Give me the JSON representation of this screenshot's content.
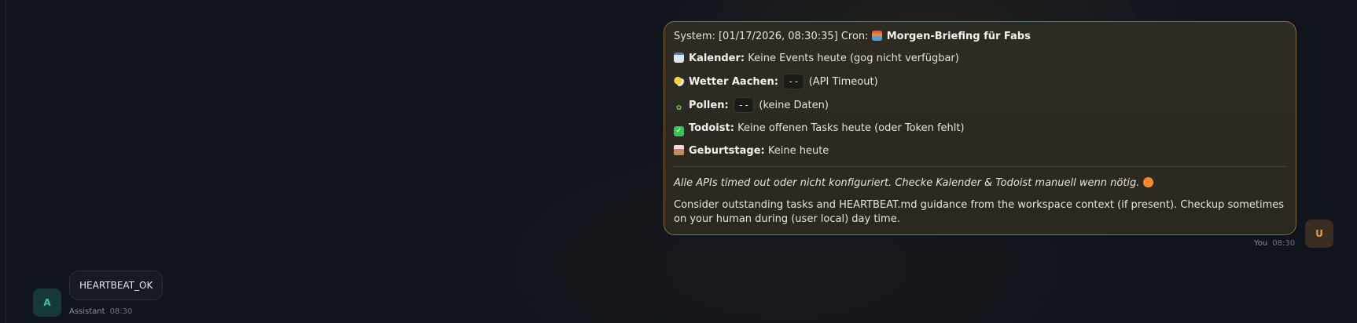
{
  "user_message": {
    "header_prefix": "System: [01/17/2026, 08:30:35] Cron:",
    "header_title": "Morgen-Briefing für Fabs",
    "items": [
      {
        "icon": "calendar-icon",
        "label": "Kalender:",
        "text": "Keine Events heute (gog nicht verfügbar)"
      },
      {
        "icon": "sun-behind-cloud-icon",
        "label": "Wetter Aachen:",
        "code": "--",
        "text": "(API Timeout)"
      },
      {
        "icon": "herb-icon",
        "label": "Pollen:",
        "code": "--",
        "text": "(keine Daten)"
      },
      {
        "icon": "check-mark-icon",
        "label": "Todoist:",
        "text": "Keine offenen Tasks heute (oder Token fehlt)"
      },
      {
        "icon": "birthday-cake-icon",
        "label": "Geburtstage:",
        "text": "Keine heute"
      }
    ],
    "note": "Alle APIs timed out oder nicht konfiguriert. Checke Kalender & Todoist manuell wenn nötig.",
    "footer": "Consider outstanding tasks and HEARTBEAT.md guidance from the workspace context (if present). Checkup sometimes on your human during (user local) day time.",
    "sender": "You",
    "time": "08:30",
    "avatar_letter": "U"
  },
  "assistant_message": {
    "text": "HEARTBEAT_OK",
    "sender": "Assistant",
    "time": "08:30",
    "avatar_letter": "A"
  },
  "colors": {
    "background": "#10141d",
    "user_bubble_border": "#8a6b34",
    "user_accent": "#e79a4c",
    "assistant_accent": "#41c3a8"
  }
}
